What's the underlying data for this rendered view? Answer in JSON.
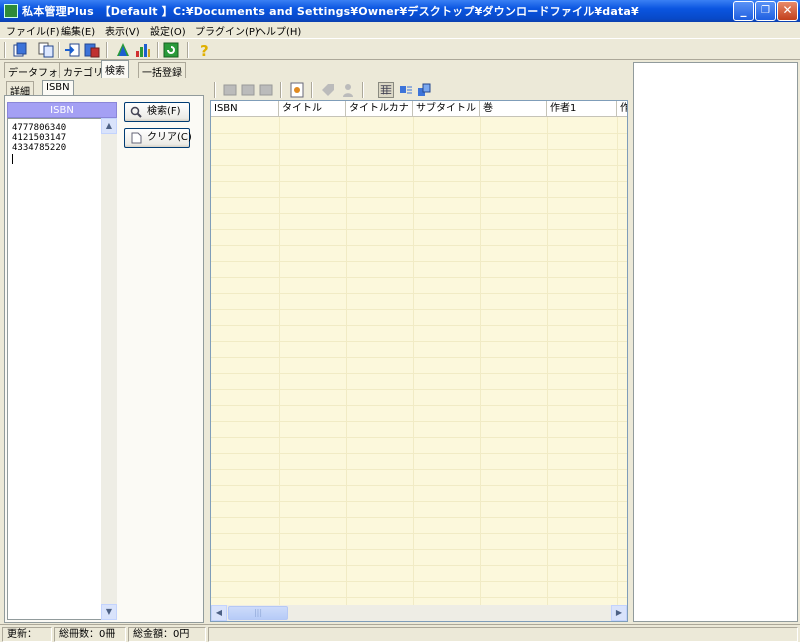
{
  "window": {
    "title": "私本管理Plus　【Default 】C:¥Documents and Settings¥Owner¥デスクトップ¥ダウンロードファイル¥data¥",
    "minimize_glyph": "_",
    "maximize_glyph": "❐",
    "close_glyph": "✕"
  },
  "menu": [
    "ファイル(F)",
    "編集(E)",
    "表示(V)",
    "設定(O)",
    "プラグイン(P)",
    "ヘルプ(H)"
  ],
  "toolbar_icons": [
    "new-icon",
    "copy-icon",
    "import-icon",
    "export-icon",
    "tree-icon",
    "chart-icon",
    "refresh-icon",
    "help-icon"
  ],
  "main_tabs": [
    "データフォルダ",
    "カテゴリー",
    "検索",
    "一括登録"
  ],
  "search_tabs": [
    "詳細",
    "ISBN"
  ],
  "isbn_panel": {
    "header": "ISBN",
    "values": [
      "4777806340",
      "4121503147",
      "4334785220"
    ]
  },
  "buttons": {
    "search": "検索(F)",
    "clear": "クリア(C)"
  },
  "grid": {
    "columns": [
      "ISBN",
      "タイトル",
      "タイトルカナ",
      "サブタイトル",
      "巻",
      "作者1",
      "作"
    ],
    "scroll_grip": "|||"
  },
  "status": {
    "updated": "更新：",
    "total_count": "総冊数：0冊",
    "total_amount": "総金額：0円"
  },
  "colors": {
    "titlebar": "#0a55e0",
    "grid_background": "#fcf8dc",
    "isbn_header": "#a4a0f4"
  }
}
